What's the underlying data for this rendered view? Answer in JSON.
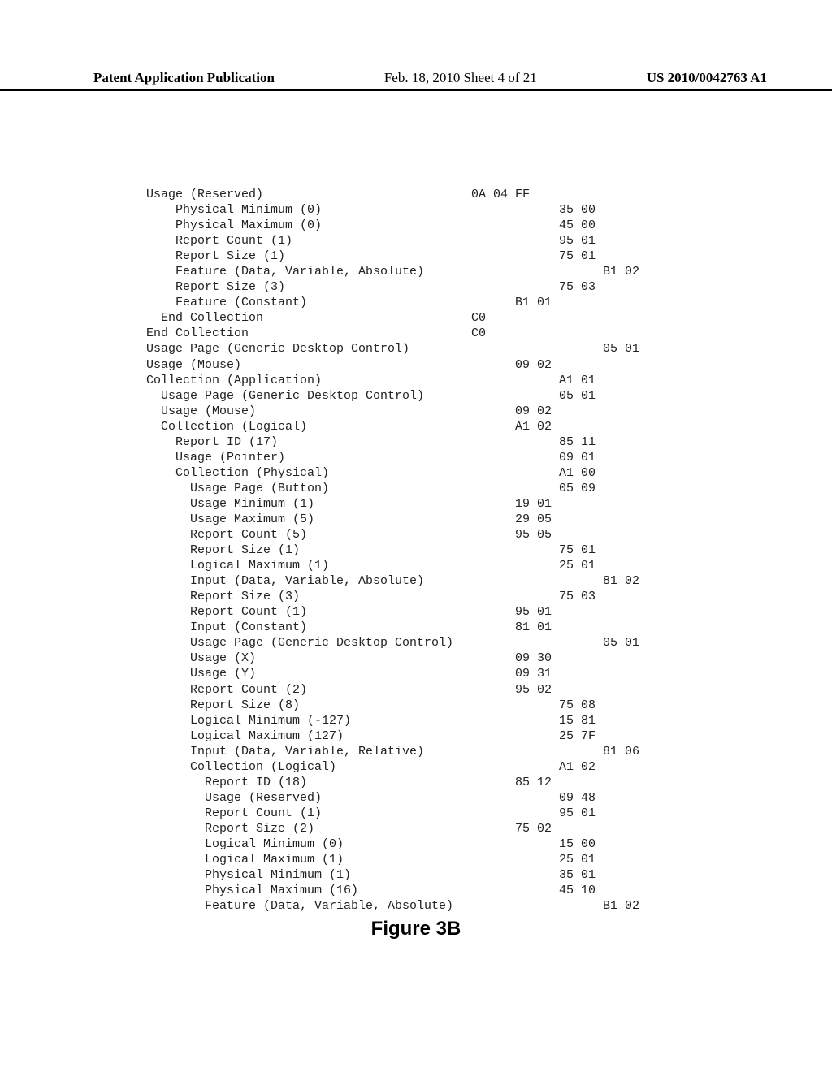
{
  "header": {
    "left": "Patent Application Publication",
    "mid": "Feb. 18, 2010  Sheet 4 of 21",
    "right": "US 2010/0042763 A1"
  },
  "figcap": "Figure 3B",
  "lines": [
    {
      "indent": 0,
      "text": "Usage (Reserved)",
      "hexcol": 0,
      "hex": "0A 04 FF"
    },
    {
      "indent": 2,
      "text": "Physical Minimum (0)",
      "hexcol": 2,
      "hex": "35 00"
    },
    {
      "indent": 2,
      "text": "Physical Maximum (0)",
      "hexcol": 2,
      "hex": "45 00"
    },
    {
      "indent": 2,
      "text": "Report Count (1)",
      "hexcol": 2,
      "hex": "95 01"
    },
    {
      "indent": 2,
      "text": "Report Size (1)",
      "hexcol": 2,
      "hex": "75 01"
    },
    {
      "indent": 2,
      "text": "Feature (Data, Variable, Absolute)",
      "hexcol": 3,
      "hex": "B1 02"
    },
    {
      "indent": 2,
      "text": "Report Size (3)",
      "hexcol": 2,
      "hex": "75 03"
    },
    {
      "indent": 2,
      "text": "Feature (Constant)",
      "hexcol": 1,
      "hex": "B1 01"
    },
    {
      "indent": 1,
      "text": "End Collection",
      "hexcol": 0,
      "hex": "C0"
    },
    {
      "indent": 0,
      "text": "End Collection",
      "hexcol": 0,
      "hex": "C0"
    },
    {
      "indent": 0,
      "text": "Usage Page (Generic Desktop Control)",
      "hexcol": 3,
      "hex": "05 01"
    },
    {
      "indent": 0,
      "text": "Usage (Mouse)",
      "hexcol": 1,
      "hex": "09 02"
    },
    {
      "indent": 0,
      "text": "Collection (Application)",
      "hexcol": 2,
      "hex": "A1 01"
    },
    {
      "indent": 1,
      "text": "Usage Page (Generic Desktop Control)",
      "hexcol": 2,
      "hex": "05 01"
    },
    {
      "indent": 1,
      "text": "Usage (Mouse)",
      "hexcol": 1,
      "hex": "09 02"
    },
    {
      "indent": 1,
      "text": "Collection (Logical)",
      "hexcol": 1,
      "hex": "A1 02"
    },
    {
      "indent": 2,
      "text": "Report ID (17)",
      "hexcol": 2,
      "hex": "85 11"
    },
    {
      "indent": 2,
      "text": "Usage (Pointer)",
      "hexcol": 2,
      "hex": "09 01"
    },
    {
      "indent": 2,
      "text": "Collection (Physical)",
      "hexcol": 2,
      "hex": "A1 00"
    },
    {
      "indent": 3,
      "text": "Usage Page (Button)",
      "hexcol": 2,
      "hex": "05 09"
    },
    {
      "indent": 3,
      "text": "Usage Minimum (1)",
      "hexcol": 1,
      "hex": "19 01"
    },
    {
      "indent": 3,
      "text": "Usage Maximum (5)",
      "hexcol": 1,
      "hex": "29 05"
    },
    {
      "indent": 3,
      "text": "Report Count (5)",
      "hexcol": 1,
      "hex": "95 05"
    },
    {
      "indent": 3,
      "text": "Report Size (1)",
      "hexcol": 2,
      "hex": "75 01"
    },
    {
      "indent": 3,
      "text": "Logical Maximum (1)",
      "hexcol": 2,
      "hex": "25 01"
    },
    {
      "indent": 3,
      "text": "Input (Data, Variable, Absolute)",
      "hexcol": 3,
      "hex": "81 02"
    },
    {
      "indent": 3,
      "text": "Report Size (3)",
      "hexcol": 2,
      "hex": "75 03"
    },
    {
      "indent": 3,
      "text": "Report Count (1)",
      "hexcol": 1,
      "hex": "95 01"
    },
    {
      "indent": 3,
      "text": "Input (Constant)",
      "hexcol": 1,
      "hex": "81 01"
    },
    {
      "indent": 3,
      "text": "Usage Page (Generic Desktop Control)",
      "hexcol": 3,
      "hex": "05 01"
    },
    {
      "indent": 3,
      "text": "Usage (X)",
      "hexcol": 1,
      "hex": "09 30"
    },
    {
      "indent": 3,
      "text": "Usage (Y)",
      "hexcol": 1,
      "hex": "09 31"
    },
    {
      "indent": 3,
      "text": "Report Count (2)",
      "hexcol": 1,
      "hex": "95 02"
    },
    {
      "indent": 3,
      "text": "Report Size (8)",
      "hexcol": 2,
      "hex": "75 08"
    },
    {
      "indent": 3,
      "text": "Logical Minimum (-127)",
      "hexcol": 2,
      "hex": "15 81"
    },
    {
      "indent": 3,
      "text": "Logical Maximum (127)",
      "hexcol": 2,
      "hex": "25 7F"
    },
    {
      "indent": 3,
      "text": "Input (Data, Variable, Relative)",
      "hexcol": 3,
      "hex": "81 06"
    },
    {
      "indent": 3,
      "text": "Collection (Logical)",
      "hexcol": 2,
      "hex": "A1 02"
    },
    {
      "indent": 4,
      "text": "Report ID (18)",
      "hexcol": 1,
      "hex": "85 12"
    },
    {
      "indent": 4,
      "text": "Usage (Reserved)",
      "hexcol": 2,
      "hex": "09 48"
    },
    {
      "indent": 4,
      "text": "Report Count (1)",
      "hexcol": 2,
      "hex": "95 01"
    },
    {
      "indent": 4,
      "text": "Report Size (2)",
      "hexcol": 1,
      "hex": "75 02"
    },
    {
      "indent": 4,
      "text": "Logical Minimum (0)",
      "hexcol": 2,
      "hex": "15 00"
    },
    {
      "indent": 4,
      "text": "Logical Maximum (1)",
      "hexcol": 2,
      "hex": "25 01"
    },
    {
      "indent": 4,
      "text": "Physical Minimum (1)",
      "hexcol": 2,
      "hex": "35 01"
    },
    {
      "indent": 4,
      "text": "Physical Maximum (16)",
      "hexcol": 2,
      "hex": "45 10"
    },
    {
      "indent": 4,
      "text": "Feature (Data, Variable, Absolute)",
      "hexcol": 3,
      "hex": "B1 02"
    }
  ],
  "indentUnit": "  ",
  "hexOffsets": [
    0,
    6,
    12,
    18
  ]
}
